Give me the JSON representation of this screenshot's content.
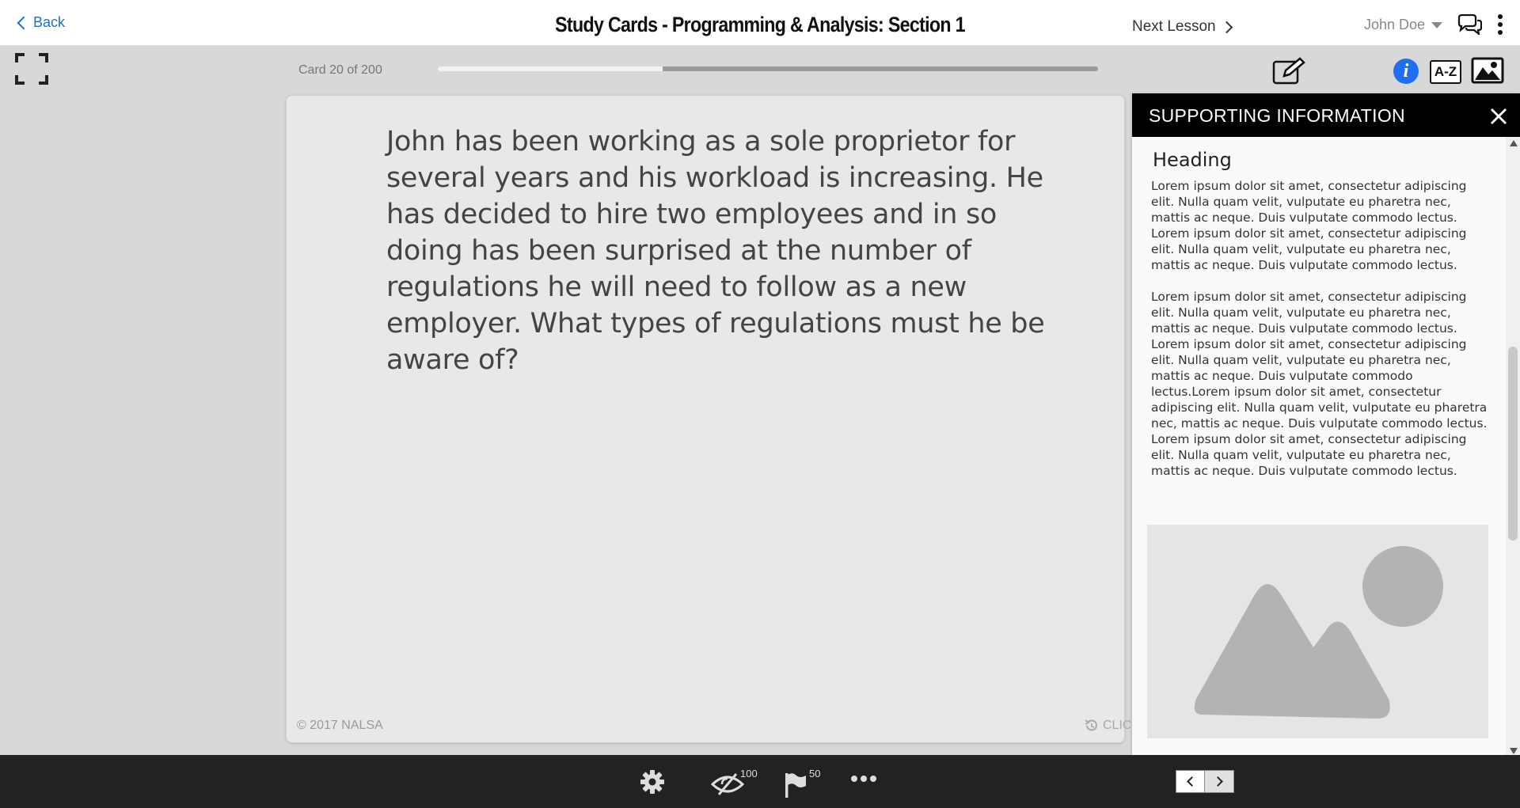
{
  "header": {
    "back_label": "Back",
    "title": "Study Cards - Programming & Analysis: Section 1",
    "next_lesson_label": "Next Lesson",
    "user_name": "John Doe"
  },
  "toolbar": {
    "card_counter": "Card 20 of 200",
    "progress_fraction": 0.34,
    "icons": [
      "fullscreen-icon",
      "edit-icon",
      "info-icon",
      "glossary-az-icon",
      "image-icon"
    ],
    "glossary_label": "A-Z",
    "info_glyph": "i"
  },
  "card": {
    "question": "John has been working as a sole proprietor for several years and his workload is increasing. He has decided to hire two employees and in so doing has been surprised at the number of regulations he will need to follow as a new employer. What types of regulations must he be aware of?",
    "copyright": "© 2017 NALSA",
    "flip_hint": "CLICK"
  },
  "panel": {
    "title": "SUPPORTING INFORMATION",
    "heading": "Heading",
    "paragraph_1": "Lorem ipsum dolor sit amet, consectetur adipiscing elit. Nulla quam velit, vulputate eu pharetra nec, mattis ac neque. Duis vulputate commodo lectus. Lorem ipsum dolor sit amet, consectetur adipiscing elit. Nulla quam velit, vulputate eu pharetra nec, mattis ac neque. Duis vulputate commodo lectus.",
    "paragraph_2": "Lorem ipsum dolor sit amet, consectetur adipiscing elit. Nulla quam  velit, vulputate eu pharetra nec, mattis ac neque. Duis vulputate  commodo lectus. Lorem ipsum dolor sit amet, consectetur adipiscing elit.  Nulla quam velit, vulputate eu pharetra nec, mattis ac neque. Duis  vulputate commodo lectus.Lorem ipsum dolor sit amet, consectetur adipiscing elit. Nulla quam  velit, vulputate eu pharetra nec, mattis ac neque. Duis vulputate  commodo lectus. Lorem ipsum dolor sit amet, consectetur adipiscing elit.  Nulla quam velit, vulputate eu pharetra nec, mattis ac neque. Duis  vulputate commodo lectus."
  },
  "bottom_bar": {
    "hidden_count": "100",
    "flagged_count": "50",
    "icons": [
      "settings-gear-icon",
      "hidden-eye-icon",
      "flag-icon",
      "more-options-icon"
    ]
  },
  "colors": {
    "accent_blue": "#1a73c8",
    "info_blue": "#1f6ff0",
    "bottom_bar": "#222222",
    "panel_header": "#000000",
    "page_background": "#d8d8d8",
    "card_background": "#e8e8e8"
  }
}
